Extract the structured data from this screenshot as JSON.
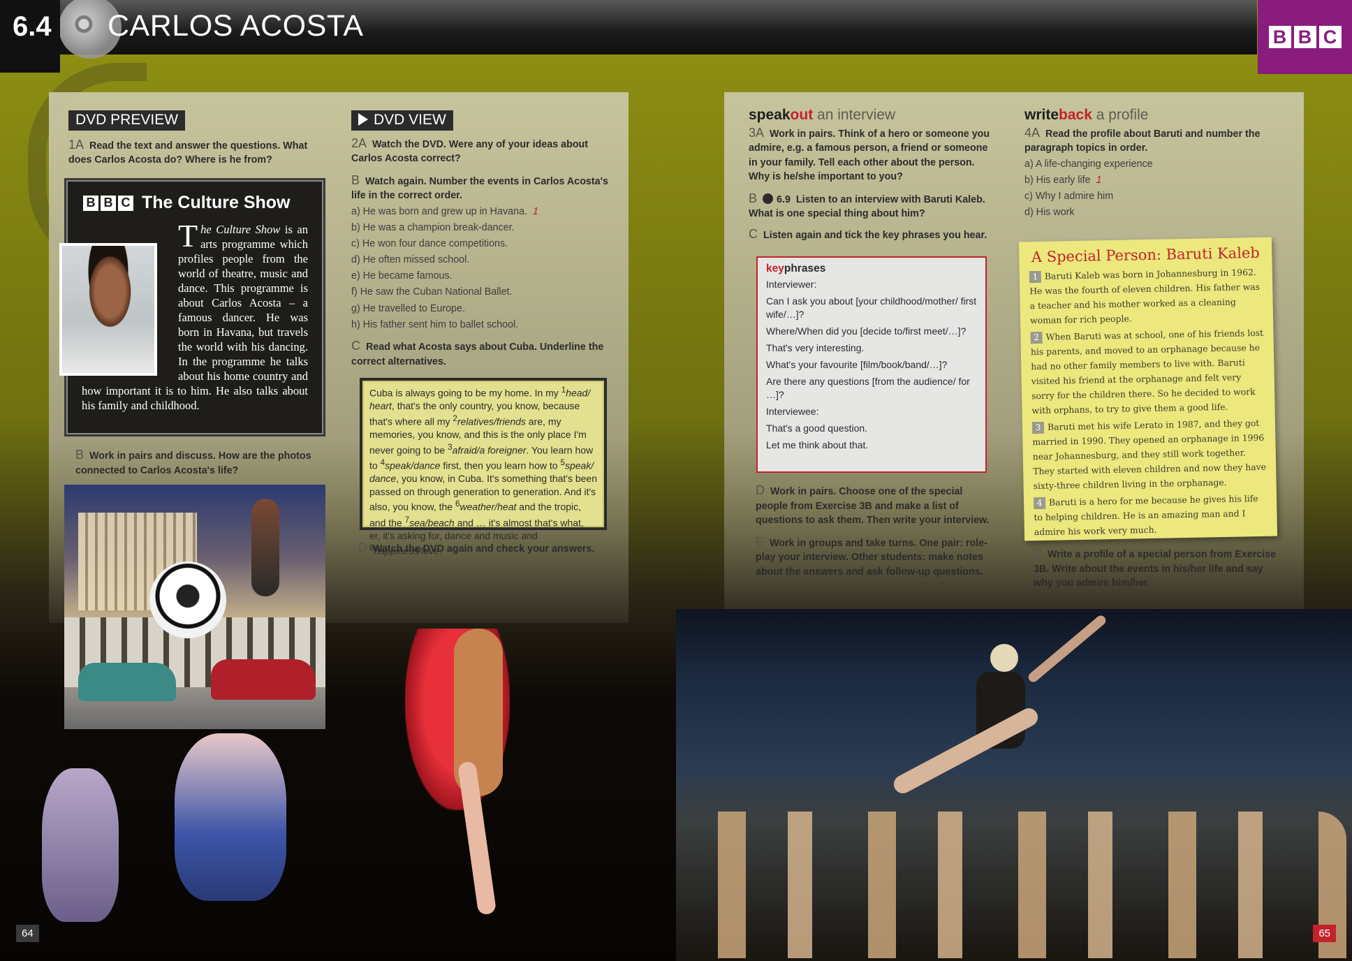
{
  "header": {
    "unit": "6.4",
    "title": "CARLOS ACOSTA",
    "brand": "BBC"
  },
  "left": {
    "preview_label": "DVD PREVIEW",
    "view_label": "DVD VIEW",
    "ex1A": {
      "num": "1A",
      "text": "Read the text and answer the questions. What does Carlos Acosta do? Where is he from?"
    },
    "culture": {
      "brand": "BBC",
      "title": "The Culture Show",
      "dropcap": "T",
      "italic": "he Culture Show",
      "text": " is an arts programme which profiles people from the world of theatre, music and dance. This programme is about Carlos Acosta – a famous dancer. He was born in Havana, but travels the world with his dancing. In the programme he talks about his home country and how important it is to him. He also talks about his family and childhood."
    },
    "exB": {
      "num": "B",
      "text": "Work in pairs and discuss. How are the photos connected to Carlos Acosta's life?"
    },
    "ex2A": {
      "num": "2A",
      "text": "Watch the DVD. Were any of your ideas about Carlos Acosta correct?"
    },
    "ex2B": {
      "num": "B",
      "text": "Watch again. Number the events in Carlos Acosta's life in the correct order."
    },
    "events": [
      {
        "text": "a) He was born and grew up in Havana.",
        "mark": "1"
      },
      {
        "text": "b) He was a champion break-dancer.",
        "mark": ""
      },
      {
        "text": "c) He won four dance competitions.",
        "mark": ""
      },
      {
        "text": "d) He often missed school.",
        "mark": ""
      },
      {
        "text": "e) He became famous.",
        "mark": ""
      },
      {
        "text": "f) He saw the Cuban National Ballet.",
        "mark": ""
      },
      {
        "text": "g) He travelled to Europe.",
        "mark": ""
      },
      {
        "text": "h) His father sent him to ballet school.",
        "mark": ""
      }
    ],
    "ex2C": {
      "num": "C",
      "text": "Read what Acosta says about Cuba. Underline the correct alternatives."
    },
    "passage": {
      "p1": "Cuba is always going to be my home. In my ",
      "s1": "1",
      "a1": "head/ heart",
      "p2": ", that's the only country, you know, because that's where all my ",
      "s2": "2",
      "a2": "relatives/friends",
      "p3": " are, my memories, you know, and this is the only place I'm never going to be ",
      "s3": "3",
      "a3": "afraid/a foreigner",
      "p4": ". You learn how to ",
      "s4": "4",
      "a4": "speak/dance",
      "p5": " first, then you learn how to ",
      "s5": "5",
      "a5": "speak/ dance",
      "p6": ", you know, in Cuba. It's something that's been passed on through generation to generation. And it's also, you know, the ",
      "s6": "6",
      "a6": "weather/heat",
      "p7": " and the tropic, and the ",
      "s7": "7",
      "a7": "sea/beach",
      "p8": " and … it's almost that's what, er, it's asking for, dance and music and ",
      "s8": "8",
      "a8": "happiness/love",
      "p9": "."
    },
    "ex2D": {
      "num": "D",
      "text": "Watch the DVD again and check your answers."
    },
    "page": "64"
  },
  "right": {
    "speak": {
      "a": "speak",
      "b": "out",
      "c": " an interview"
    },
    "write": {
      "a": "write",
      "b": "back",
      "c": " a profile"
    },
    "ex3A": {
      "num": "3A",
      "text": "Work in pairs. Think of a hero or someone you admire, e.g. a famous person, a friend or someone in your family. Tell each other about the person. Why is he/she important to you?"
    },
    "ex3B": {
      "num": "B",
      "audio": "6.9",
      "text": "Listen to an interview with Baruti Kaleb. What is one special thing about him?"
    },
    "ex3C": {
      "num": "C",
      "text": "Listen again and tick the key phrases you hear."
    },
    "keyphrases": {
      "k1": "key",
      "k2": "phrases",
      "interviewer": "Interviewer:",
      "q": [
        "Can I ask you about [your childhood/mother/ first wife/…]?",
        "Where/When did you [decide to/first meet/…]?",
        "That's very interesting.",
        "What's your favourite [film/book/band/…]?",
        "Are there any questions [from the audience/ for …]?"
      ],
      "interviewee": "Interviewee:",
      "a": [
        "That's a good question.",
        "Let me think about that."
      ]
    },
    "ex3D": {
      "num": "D",
      "text": "Work in pairs. Choose one of the special people from Exercise 3B and make a list of questions to ask them. Then write your interview."
    },
    "ex3E": {
      "num": "E",
      "text": "Work in groups and take turns. One pair: role-play your interview. Other students: make notes about the answers and ask follow-up questions."
    },
    "ex4A": {
      "num": "4A",
      "text": "Read the profile about Baruti and number the paragraph topics in order."
    },
    "topics": [
      {
        "text": "a) A life-changing experience",
        "mark": ""
      },
      {
        "text": "b) His early life",
        "mark": "1"
      },
      {
        "text": "c) Why I admire him",
        "mark": ""
      },
      {
        "text": "d) His work",
        "mark": ""
      }
    ],
    "note": {
      "title": "A Special Person: Baruti Kaleb",
      "paras": [
        {
          "n": "1",
          "t": "Baruti Kaleb was born in Johannesburg in 1962. He was the fourth of eleven children. His father was a teacher and his mother worked as a cleaning woman for rich people."
        },
        {
          "n": "2",
          "t": "When Baruti was at school, one of his friends lost his parents, and moved to an orphanage because he had no other family members to live with. Baruti visited his friend at the orphanage and felt very sorry for the children there. So he decided to work with orphans, to try to give them a good life."
        },
        {
          "n": "3",
          "t": "Baruti met his wife Lerato in 1987, and they got married in 1990. They opened an orphanage in 1996 near Johannesburg, and they still work together. They started with eleven children and now they have sixty-three children living in the orphanage."
        },
        {
          "n": "4",
          "t": "Baruti is a hero for me because he gives his life to helping children. He is an amazing man and I admire his work very much."
        }
      ]
    },
    "ex4B": {
      "num": "B",
      "text": "Write a profile of a special person from Exercise 3B. Write about the events in his/her life and say why you admire him/her."
    },
    "page": "65"
  },
  "colors": {
    "olive": "#8c8d12",
    "red": "#c2232c",
    "bbc_purple": "#8a1c7d",
    "note_yellow": "#ece87e"
  }
}
